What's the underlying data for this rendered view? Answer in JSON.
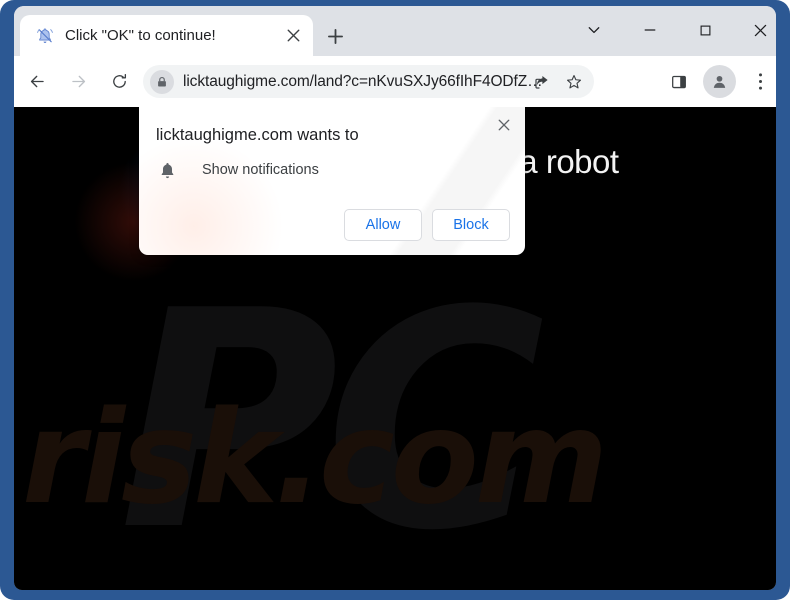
{
  "window": {
    "controls": [
      {
        "name": "tab-search",
        "icon": "chevron-down-icon",
        "label": ""
      },
      {
        "name": "minimize",
        "icon": "minimize-icon",
        "label": ""
      },
      {
        "name": "maximize",
        "icon": "maximize-icon",
        "label": ""
      },
      {
        "name": "close",
        "icon": "close-icon",
        "label": ""
      }
    ],
    "frame_color": "#2c5893"
  },
  "tabstrip": {
    "tab": {
      "title": "Click \"OK\" to continue!",
      "favicon": "bell-slash-icon",
      "close_label": "×"
    },
    "new_tab_label": "+"
  },
  "toolbar": {
    "back_icon": "back-arrow-icon",
    "forward_icon": "forward-arrow-icon",
    "reload_icon": "reload-icon",
    "omnibox": {
      "lock_icon": "lock-icon",
      "url_host": "licktaughigme.com",
      "url_path": "/land?c=nKvuSXJy66fIhF4ODfZ…",
      "url_full": "licktaughigme.com/land?c=nKvuSXJy66fIhF4ODfZ…",
      "share_icon": "share-icon",
      "star_icon": "star-icon"
    },
    "side_panel_icon": "side-panel-icon",
    "profile_icon": "profile-avatar-icon",
    "menu_icon": "three-dot-menu-icon"
  },
  "page": {
    "background_color": "#000000",
    "headline": "Click \"OK\" if you are not a robot",
    "watermark_top": "PC",
    "watermark_bottom": "risk.com"
  },
  "permission_dialog": {
    "title": "licktaughigme.com wants to",
    "close_label": "×",
    "permission_icon": "bell-icon",
    "permission_label": "Show notifications",
    "allow_label": "Allow",
    "block_label": "Block",
    "accent_color": "#1a73e8"
  }
}
